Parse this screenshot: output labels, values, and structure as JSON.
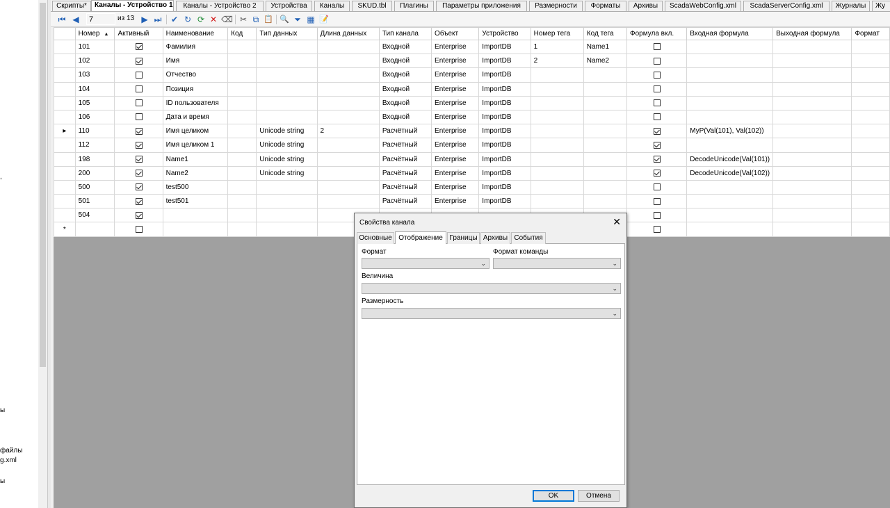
{
  "left_panel": {
    "fragments": [
      "ы",
      "файлы",
      "g.xml",
      "ы"
    ]
  },
  "tabs": [
    {
      "label": "Скрипты*",
      "active": false
    },
    {
      "label": "Каналы - Устройство 1",
      "active": true
    },
    {
      "label": "Каналы - Устройство 2",
      "active": false
    },
    {
      "label": "Устройства",
      "active": false
    },
    {
      "label": "Каналы",
      "active": false
    },
    {
      "label": "SKUD.tbl",
      "active": false
    },
    {
      "label": "Плагины",
      "active": false
    },
    {
      "label": "Параметры приложения",
      "active": false
    },
    {
      "label": "Размерности",
      "active": false
    },
    {
      "label": "Форматы",
      "active": false
    },
    {
      "label": "Архивы",
      "active": false
    },
    {
      "label": "ScadaWebConfig.xml",
      "active": false
    },
    {
      "label": "ScadaServerConfig.xml",
      "active": false
    },
    {
      "label": "Журналы",
      "active": false
    },
    {
      "label": "Жу",
      "active": false
    }
  ],
  "toolbar": {
    "position": "7",
    "count": "из 13",
    "icons": {
      "first": "⏮",
      "prev": "◀",
      "next": "▶",
      "last": "⏭",
      "apply": "✔",
      "refresh": "↻",
      "reload": "⟳",
      "delete": "✕",
      "clear": "⌫",
      "cut": "✂",
      "copy": "⧉",
      "paste": "📋",
      "find": "🔍",
      "filter": "⏷",
      "autosize": "▦",
      "properties": "📝"
    }
  },
  "grid": {
    "columns": [
      "Номер",
      "Активный",
      "Наименование",
      "Код",
      "Тип данных",
      "Длина данных",
      "Тип канала",
      "Объект",
      "Устройство",
      "Номер тега",
      "Код тега",
      "Формула вкл.",
      "Входная формула",
      "Выходная формула",
      "Формат"
    ],
    "current_marker": "▸",
    "new_row_marker": "*",
    "rows": [
      {
        "num": "101",
        "active": true,
        "name": "Фамилия",
        "code": "",
        "dtype": "",
        "dlen": "",
        "ctype": "Входной",
        "obj": "Enterprise",
        "dev": "ImportDB",
        "tagnum": "1",
        "tagcode": "Name1",
        "formula": false,
        "infx": "",
        "outfx": "",
        "fmt": "",
        "current": false
      },
      {
        "num": "102",
        "active": true,
        "name": "Имя",
        "code": "",
        "dtype": "",
        "dlen": "",
        "ctype": "Входной",
        "obj": "Enterprise",
        "dev": "ImportDB",
        "tagnum": "2",
        "tagcode": "Name2",
        "formula": false,
        "infx": "",
        "outfx": "",
        "fmt": "",
        "current": false
      },
      {
        "num": "103",
        "active": false,
        "name": "Отчество",
        "code": "",
        "dtype": "",
        "dlen": "",
        "ctype": "Входной",
        "obj": "Enterprise",
        "dev": "ImportDB",
        "tagnum": "",
        "tagcode": "",
        "formula": false,
        "infx": "",
        "outfx": "",
        "fmt": "",
        "current": false
      },
      {
        "num": "104",
        "active": false,
        "name": "Позиция",
        "code": "",
        "dtype": "",
        "dlen": "",
        "ctype": "Входной",
        "obj": "Enterprise",
        "dev": "ImportDB",
        "tagnum": "",
        "tagcode": "",
        "formula": false,
        "infx": "",
        "outfx": "",
        "fmt": "",
        "current": false
      },
      {
        "num": "105",
        "active": false,
        "name": "ID пользователя",
        "code": "",
        "dtype": "",
        "dlen": "",
        "ctype": "Входной",
        "obj": "Enterprise",
        "dev": "ImportDB",
        "tagnum": "",
        "tagcode": "",
        "formula": false,
        "infx": "",
        "outfx": "",
        "fmt": "",
        "current": false
      },
      {
        "num": "106",
        "active": false,
        "name": "Дата и время",
        "code": "",
        "dtype": "",
        "dlen": "",
        "ctype": "Входной",
        "obj": "Enterprise",
        "dev": "ImportDB",
        "tagnum": "",
        "tagcode": "",
        "formula": false,
        "infx": "",
        "outfx": "",
        "fmt": "",
        "current": false
      },
      {
        "num": "110",
        "active": true,
        "name": "Имя целиком",
        "code": "",
        "dtype": "Unicode string",
        "dlen": "2",
        "ctype": "Расчётный",
        "obj": "Enterprise",
        "dev": "ImportDB",
        "tagnum": "",
        "tagcode": "",
        "formula": true,
        "infx": "MyP(Val(101), Val(102))",
        "outfx": "",
        "fmt": "",
        "current": true
      },
      {
        "num": "112",
        "active": true,
        "name": "Имя целиком 1",
        "code": "",
        "dtype": "Unicode string",
        "dlen": "",
        "ctype": "Расчётный",
        "obj": "Enterprise",
        "dev": "ImportDB",
        "tagnum": "",
        "tagcode": "",
        "formula": true,
        "infx": "",
        "outfx": "",
        "fmt": "",
        "current": false
      },
      {
        "num": "198",
        "active": true,
        "name": "Name1",
        "code": "",
        "dtype": "Unicode string",
        "dlen": "",
        "ctype": "Расчётный",
        "obj": "Enterprise",
        "dev": "ImportDB",
        "tagnum": "",
        "tagcode": "",
        "formula": true,
        "infx": "DecodeUnicode(Val(101))",
        "outfx": "",
        "fmt": "",
        "current": false
      },
      {
        "num": "200",
        "active": true,
        "name": "Name2",
        "code": "",
        "dtype": "Unicode string",
        "dlen": "",
        "ctype": "Расчётный",
        "obj": "Enterprise",
        "dev": "ImportDB",
        "tagnum": "",
        "tagcode": "",
        "formula": true,
        "infx": "DecodeUnicode(Val(102))",
        "outfx": "",
        "fmt": "",
        "current": false
      },
      {
        "num": "500",
        "active": true,
        "name": "test500",
        "code": "",
        "dtype": "",
        "dlen": "",
        "ctype": "Расчётный",
        "obj": "Enterprise",
        "dev": "ImportDB",
        "tagnum": "",
        "tagcode": "",
        "formula": false,
        "infx": "",
        "outfx": "",
        "fmt": "",
        "current": false
      },
      {
        "num": "501",
        "active": true,
        "name": "test501",
        "code": "",
        "dtype": "",
        "dlen": "",
        "ctype": "Расчётный",
        "obj": "Enterprise",
        "dev": "ImportDB",
        "tagnum": "",
        "tagcode": "",
        "formula": false,
        "infx": "",
        "outfx": "",
        "fmt": "",
        "current": false
      },
      {
        "num": "504",
        "active": true,
        "name": "",
        "code": "",
        "dtype": "",
        "dlen": "",
        "ctype": "",
        "obj": "",
        "dev": "",
        "tagnum": "",
        "tagcode": "",
        "formula": false,
        "infx": "",
        "outfx": "",
        "fmt": "",
        "current": false
      }
    ]
  },
  "dialog": {
    "title": "Свойства канала",
    "close_icon": "✕",
    "tabs": [
      "Основные",
      "Отображение",
      "Границы",
      "Архивы",
      "События"
    ],
    "active_tab": "Отображение",
    "fields": {
      "format_label": "Формат",
      "format_value": "",
      "cmd_format_label": "Формат команды",
      "cmd_format_value": "",
      "quantity_label": "Величина",
      "quantity_value": "",
      "unit_label": "Размерность",
      "unit_value": "",
      "chevron": "⌄"
    },
    "ok_label": "OK",
    "cancel_label": "Отмена"
  }
}
